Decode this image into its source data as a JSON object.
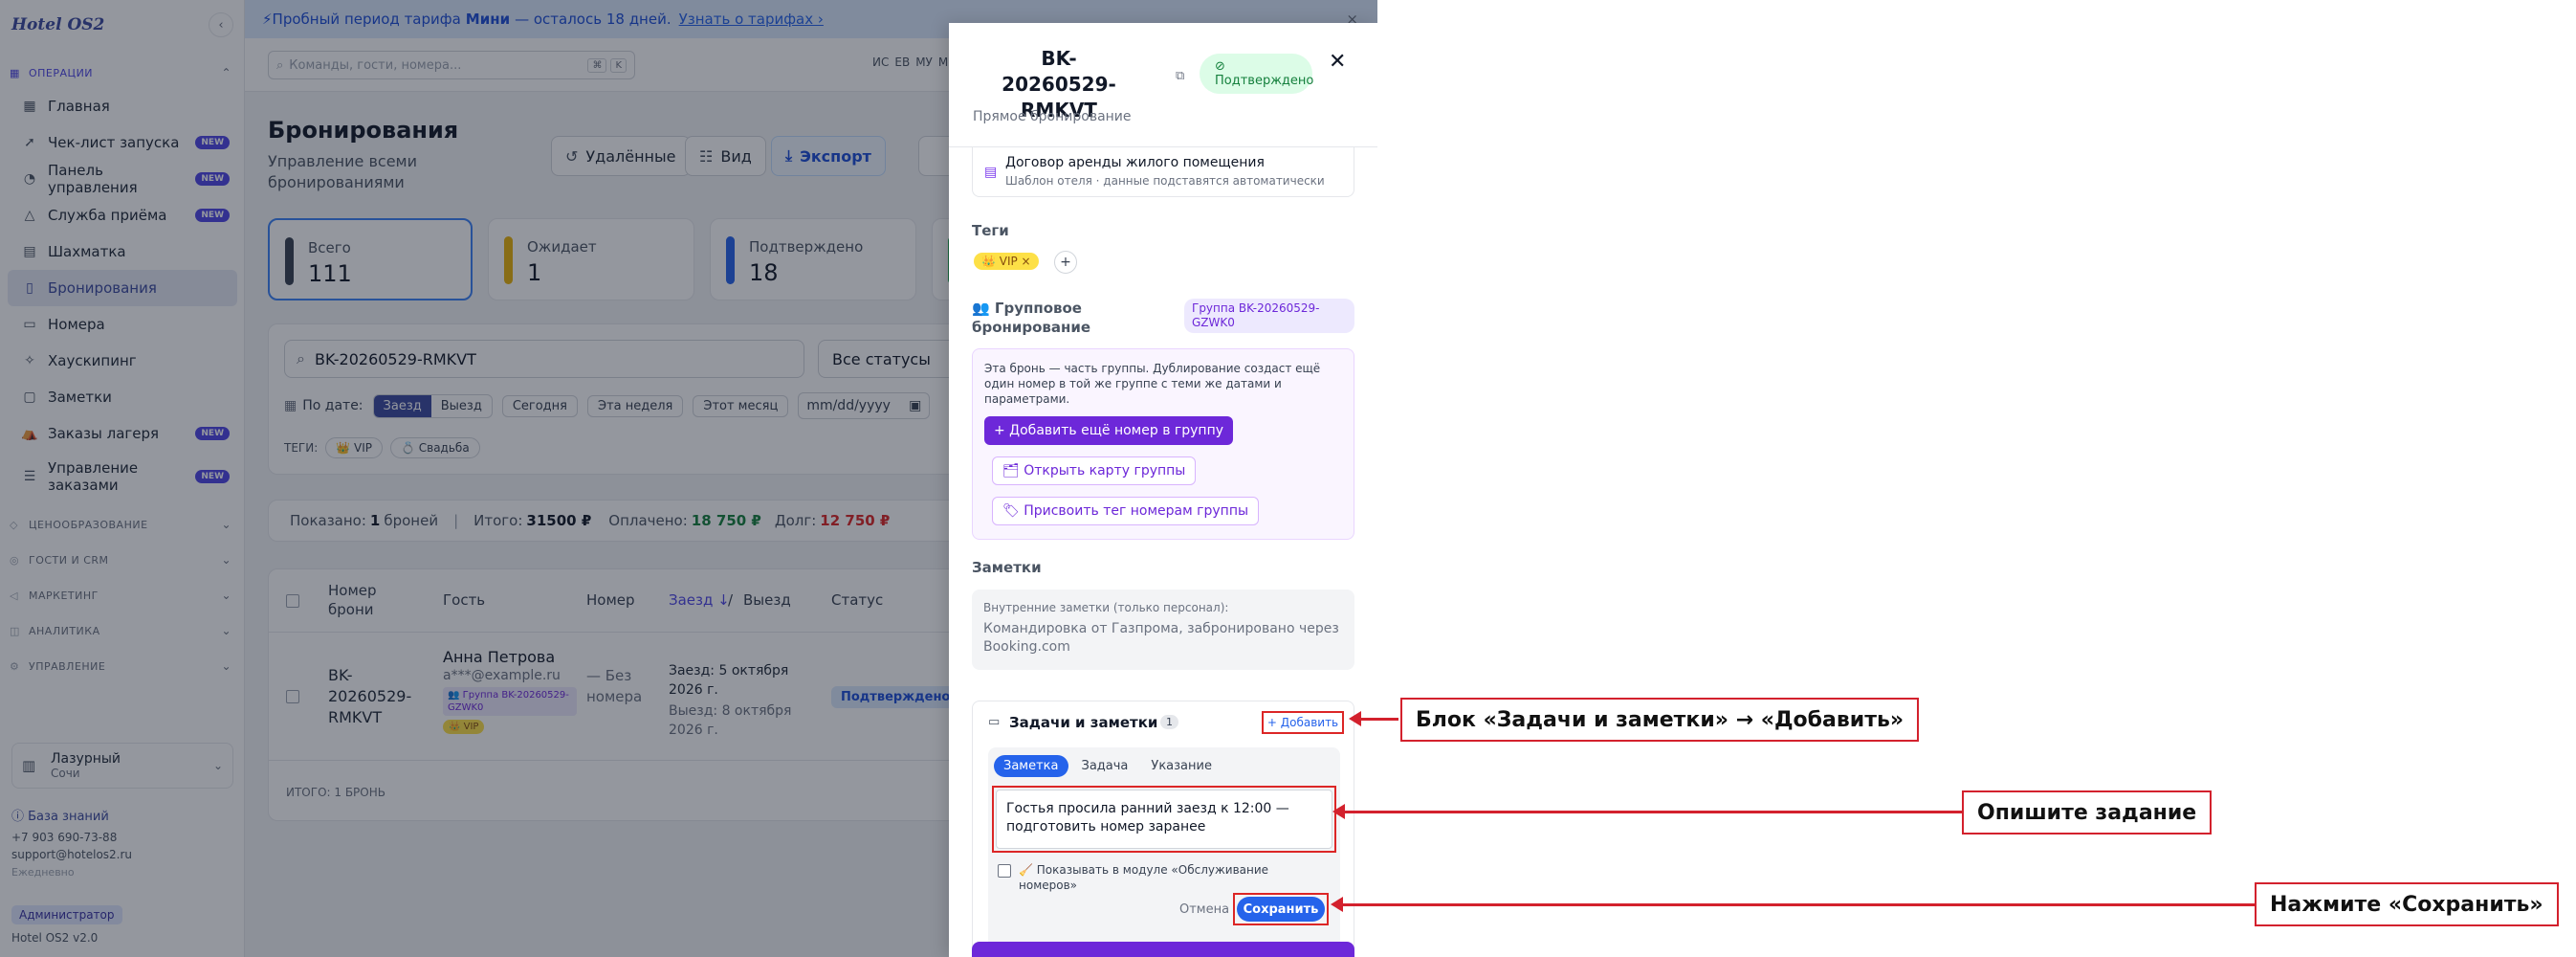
{
  "app": {
    "logo": "Hotel OS2",
    "collapse_icon": "chevron-left-icon",
    "sections": {
      "operations": "ОПЕРАЦИИ",
      "pricing": "ЦЕНООБРАЗОВАНИЕ",
      "guests": "ГОСТИ И CRM",
      "marketing": "МАРКЕТИНГ",
      "analytics": "АНАЛИТИКА",
      "management": "УПРАВЛЕНИЕ"
    },
    "nav": [
      {
        "label": "Главная",
        "icon": "grid-icon",
        "badge": ""
      },
      {
        "label": "Чек-лист запуска",
        "icon": "rocket-icon",
        "badge": "NEW"
      },
      {
        "label": "Панель управления",
        "icon": "gauge-icon",
        "badge": "NEW"
      },
      {
        "label": "Служба приёма",
        "icon": "bell-icon",
        "badge": "NEW"
      },
      {
        "label": "Шахматка",
        "icon": "calendar-grid-icon",
        "badge": ""
      },
      {
        "label": "Бронирования",
        "icon": "clipboard-icon",
        "badge": "",
        "active": true
      },
      {
        "label": "Номера",
        "icon": "door-icon",
        "badge": ""
      },
      {
        "label": "Хаускипинг",
        "icon": "sparkles-icon",
        "badge": ""
      },
      {
        "label": "Заметки",
        "icon": "note-icon",
        "badge": ""
      },
      {
        "label": "Заказы лагеря",
        "icon": "tent-icon",
        "badge": "NEW"
      },
      {
        "label": "Управление заказами",
        "icon": "list-icon",
        "badge": "NEW"
      }
    ],
    "hotel": {
      "name": "Лазурный",
      "city": "Сочи"
    },
    "kb_link": "База знаний",
    "phone": "+7 903 690-73-88",
    "email": "support@hotelos2.ru",
    "hours": "Ежедневно",
    "role": "Администратор",
    "version": "Hotel OS2 v2.0"
  },
  "trial": {
    "prefix": "Пробный период тарифа",
    "plan": "Мини",
    "remaining": "— осталось 18 дней.",
    "link": "Узнать о тарифах ›"
  },
  "topbar": {
    "search_placeholder": "Команды, гости, номера...",
    "kbd1": "⌘",
    "kbd2": "K",
    "avatars": [
      "ИС",
      "ЕВ",
      "МУ",
      "МП"
    ]
  },
  "page": {
    "title": "Бронирования",
    "subtitle": "Управление всеми бронированиями",
    "btn_deleted": "Удалённые",
    "btn_view": "Вид",
    "btn_export": "Экспорт",
    "stats": [
      {
        "label": "Всего",
        "value": "111",
        "color": "#374151"
      },
      {
        "label": "Ожидает",
        "value": "1",
        "color": "#eab308"
      },
      {
        "label": "Подтверждено",
        "value": "18",
        "color": "#2563eb"
      }
    ],
    "search_value": "BK-20260529-RMKVT",
    "status_select": "Все статусы",
    "date_label": "По дате:",
    "date_seg": [
      "Заезд",
      "Выезд"
    ],
    "date_chips": [
      "Сегодня",
      "Эта неделя",
      "Этот месяц"
    ],
    "date_placeholder": "mm/dd/yyyy",
    "tags_label": "ТЕГИ:",
    "tag_chips": [
      "👑 VIP",
      "💍 Свадьба"
    ],
    "summary": {
      "shown_prefix": "Показано:",
      "shown_count": "1",
      "shown_suffix": "броней",
      "total_label": "Итого:",
      "total": "31500 ₽",
      "paid_label": "Оплачено:",
      "paid": "18 750 ₽",
      "debt_label": "Долг:",
      "debt": "12 750 ₽"
    },
    "table": {
      "headers": {
        "number": "Номер брони",
        "guest": "Гость",
        "room": "Номер",
        "checkin": "Заезд ↓",
        "slash": "/",
        "checkout": "Выезд",
        "status": "Статус"
      },
      "row": {
        "number": "BK-20260529-RMKVT",
        "guest": "Анна Петрова",
        "email": "a***@example.ru",
        "group": "👥 Группа BK-20260529-GZWK0",
        "vip": "👑 VIP",
        "room": "— Без номера",
        "checkin": "Заезд: 5 октября 2026 г.",
        "checkout": "Выезд: 8 октября 2026 г.",
        "status": "Подтверждено"
      },
      "footer": "ИТОГО: 1 БРОНЬ"
    }
  },
  "drawer": {
    "booking_id": "BK-20260529-RMKVT",
    "status": "Подтверждено",
    "source": "Прямое бронирование",
    "doc_title": "Договор аренды жилого помещения",
    "doc_sub": "Шаблон отеля · данные подставятся автоматически",
    "tags_label": "Теги",
    "vip_tag": "👑 VIP ×",
    "add_tag": "+",
    "group_title": "👥 Групповое бронирование",
    "group_badge": "Группа BK-20260529-GZWK0",
    "group_text": "Эта бронь — часть группы. Дублирование создаст ещё один номер в той же группе с теми же датами и параметрами.",
    "group_add": "+ Добавить ещё номер в группу",
    "group_open": "🗂 Открыть карту группы",
    "group_tag": "🏷 Присвоить тег номерам группы",
    "notes_label": "Заметки",
    "notes_inner_label": "Внутренние заметки (только персонал):",
    "notes_text": "Командировка от Газпрома, забронировано через Booking.com",
    "tasks_title": "Задачи и заметки",
    "tasks_count": "1",
    "tasks_add": "+ Добавить",
    "editor_tabs": [
      "Заметка",
      "Задача",
      "Указание"
    ],
    "editor_text": "Гостья просила ранний заезд к 12:00 — подготовить номер заранее",
    "editor_check_label": "🧹 Показывать в модуле «Обслуживание номеров»",
    "editor_cancel": "Отмена",
    "editor_save": "Сохранить"
  },
  "callouts": {
    "c1": "Блок «Задачи и заметки» → «Добавить»",
    "c2": "Опишите задание",
    "c3": "Нажмите «Сохранить»",
    "color": "#d3212d"
  }
}
